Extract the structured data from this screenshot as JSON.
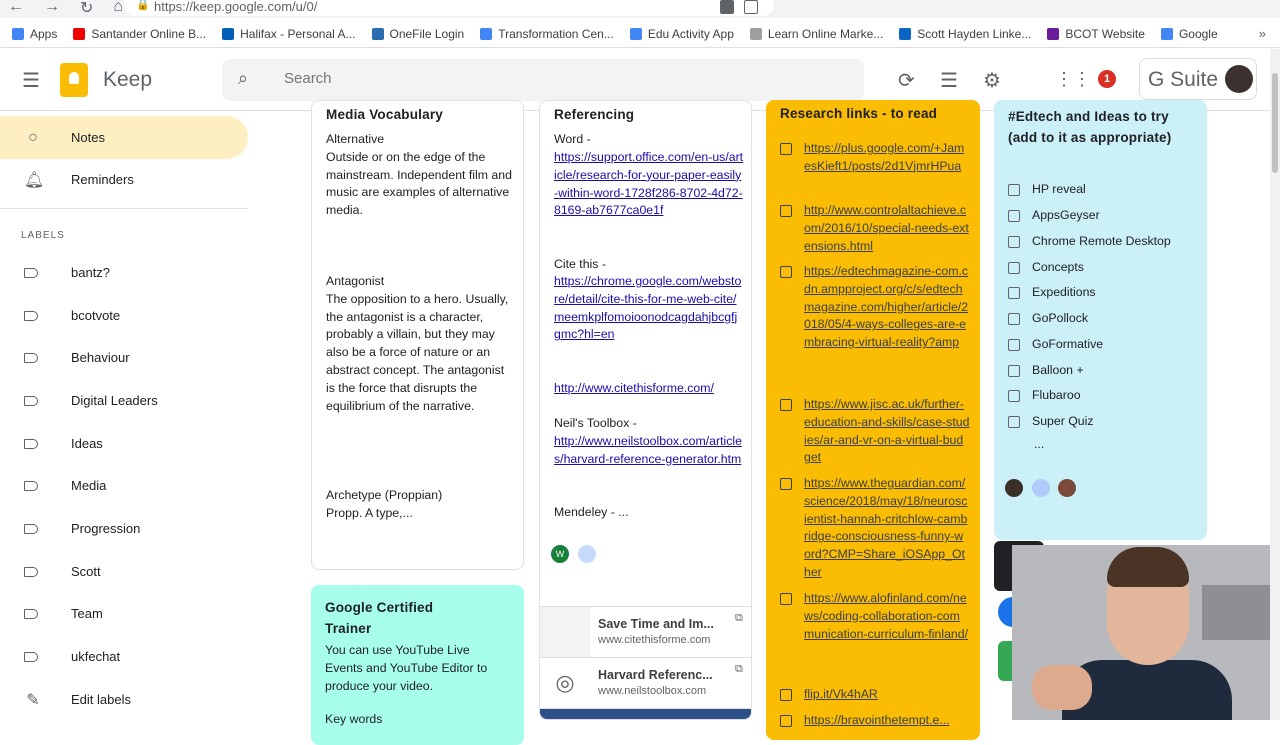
{
  "browser": {
    "url": "https://keep.google.com/u/0/",
    "nav": [
      "←",
      "→",
      "↻",
      "⌂"
    ],
    "bookmarks": [
      {
        "label": "Apps",
        "color": "#4285f4"
      },
      {
        "label": "Santander Online B...",
        "color": "#ec0000"
      },
      {
        "label": "Halifax - Personal A...",
        "color": "#005eb8"
      },
      {
        "label": "OneFile Login",
        "color": "#2b6cb0"
      },
      {
        "label": "Transformation Cen...",
        "color": "#4285f4"
      },
      {
        "label": "Edu Activity App",
        "color": "#4285f4"
      },
      {
        "label": "Learn Online Marke...",
        "color": "#9e9e9e"
      },
      {
        "label": "Scott Hayden Linke...",
        "color": "#0a66c2"
      },
      {
        "label": "BCOT Website",
        "color": "#6a1b9a"
      },
      {
        "label": "Google",
        "color": "#4285f4"
      }
    ],
    "more_bookmarks": "»"
  },
  "header": {
    "app_name": "Keep",
    "search_placeholder": "Search",
    "notification_count": "1",
    "gsuite_label": "G Suite"
  },
  "sidebar": {
    "items": [
      {
        "label": "Notes",
        "icon": "lightbulb-icon",
        "glyph": "💡"
      },
      {
        "label": "Reminders",
        "icon": "bell-icon",
        "glyph": "🔔"
      }
    ],
    "labels_heading": "LABELS",
    "labels": [
      "bantz?",
      "bcotvote",
      "Behaviour",
      "Digital Leaders",
      "Ideas",
      "Media",
      "Progression",
      "Scott",
      "Team",
      "ukfechat"
    ],
    "edit_labels": "Edit labels"
  },
  "notes": {
    "media_vocab": {
      "title": "Media Vocabulary",
      "body1": "Alternative\nOutside or on the edge of the mainstream. Independent film and music are examples of alternative media.",
      "body2": "Antagonist\nThe opposition to a hero. Usually, the antagonist is a character, probably a villain, but they may also be a force of nature or an abstract concept. The antagonist is the force that disrupts the equilibrium of the narrative.",
      "body3": "Archetype (Proppian)\nPropp.  A type,..."
    },
    "google_trainer": {
      "title": "Google Certified Trainer",
      "body": "You can use YouTube Live Events and YouTube Editor to produce your video.",
      "trailing": "Key words"
    },
    "referencing": {
      "title": "Referencing",
      "word_label": "Word -",
      "word_link": "https://support.office.com/en-us/article/research-for-your-paper-easily-within-word-1728f286-8702-4d72-8169-ab7677ca0e1f",
      "cite_label": "Cite this -",
      "cite_link": "https://chrome.google.com/webstore/detail/cite-this-for-me-web-cite/meemkplfomoioonodcagdahjbcgfjgmc?hl=en",
      "citethisforme": "http://www.citethisforme.com/",
      "neil_label": "Neil's Toolbox -",
      "neil_link": "http://www.neilstoolbox.com/articles/harvard-reference-generator.htm",
      "mendeley": "Mendeley - ...",
      "collaborator_initial": "W",
      "previews": [
        {
          "title": "Save Time and Im...",
          "domain": "www.citethisforme.com"
        },
        {
          "title": "Harvard Referenc...",
          "domain": "www.neilstoolbox.com"
        }
      ]
    },
    "research_links": {
      "title": "Research links - to read",
      "items": [
        "https://plus.google.com/+JamesKieft1/posts/2d1VjmrHPua",
        "http://www.controlaltachieve.com/2016/10/special-needs-extensions.html",
        "https://edtechmagazine-com.cdn.ampproject.org/c/s/edtechmagazine.com/higher/article/2018/05/4-ways-colleges-are-embracing-virtual-reality?amp",
        "https://www.jisc.ac.uk/further-education-and-skills/case-studies/ar-and-vr-on-a-virtual-budget",
        "https://www.theguardian.com/science/2018/may/18/neuroscientist-hannah-critchlow-cambridge-consciousness-funny-word?CMP=Share_iOSApp_Other",
        "https://www.alofinland.com/news/coding-collaboration-communication-curriculum-finland/",
        "flip.it/Vk4hAR",
        "https://bravointhetempt.e..."
      ]
    },
    "edtech": {
      "title": "#Edtech and Ideas to try (add to it as appropriate)",
      "items": [
        "HP reveal",
        "AppsGeyser",
        "Chrome Remote Desktop",
        "Concepts",
        "Expeditions",
        "GoPollock",
        "GoFormative",
        "Balloon +",
        "Flubaroo",
        "Super Quiz"
      ],
      "more": "..."
    }
  }
}
